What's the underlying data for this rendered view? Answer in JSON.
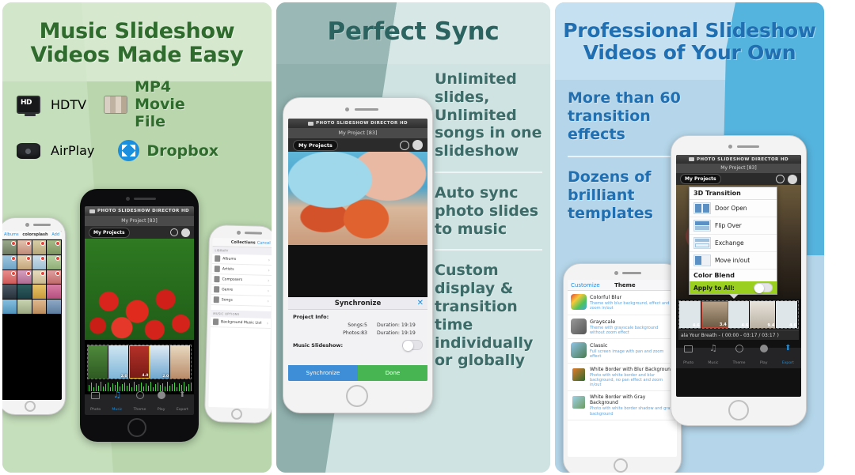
{
  "panels": [
    {
      "id": "panel-1",
      "headline": "Music Slideshow\nVideos Made Easy",
      "headline_line1": "Music Slideshow",
      "headline_line2": "Videos Made Easy",
      "accent": "#2e6b2c",
      "bg_top": "#d6e9cf",
      "bg_bottom": "#b9d6ad",
      "features": [
        {
          "icon": "hdtv-icon",
          "label": "HDTV"
        },
        {
          "icon": "mp4-film-icon",
          "label": "MP4 Movie File"
        },
        {
          "icon": "airplay-icon",
          "label": "AirPlay"
        },
        {
          "icon": "dropbox-icon",
          "label": "Dropbox"
        }
      ],
      "left_phone": {
        "nav_back": "Albums",
        "nav_title": "colorsplash",
        "nav_action": "Add"
      },
      "right_phone": {
        "nav_title": "Collections",
        "nav_action": "Cancel",
        "section_library": "LIBRARY",
        "library_items": [
          "Albums",
          "Artists",
          "Composers",
          "Genre",
          "Songs"
        ],
        "section_options": "MUSIC OPTIONS",
        "option_items": [
          "Background Music List"
        ]
      },
      "main_phone": {
        "app_name": "PHOTO SLIDESHOW DIRECTOR HD",
        "project_title": "My Project [83]",
        "projects_button": "My Projects",
        "timeline_durations": [
          "2.0",
          "4.0",
          "2.0"
        ],
        "tabs": [
          {
            "label": "Photo",
            "icon": "photo-icon",
            "active": false
          },
          {
            "label": "Music",
            "icon": "music-note-icon",
            "active": true
          },
          {
            "label": "Theme",
            "icon": "palette-icon",
            "active": false
          },
          {
            "label": "Play",
            "icon": "play-icon",
            "active": false
          },
          {
            "label": "Export",
            "icon": "export-icon",
            "active": false
          }
        ]
      }
    },
    {
      "id": "panel-2",
      "headline": "Perfect Sync",
      "accent": "#2b6360",
      "bg_light": "#cfe3e2",
      "bg_dark": "#8fb0ad",
      "bullets": [
        "Unlimited slides, Unlimited songs in one slideshow",
        "Auto sync photo slides to music",
        "Custom display & transition time individually or globally"
      ],
      "phone": {
        "app_name": "PHOTO SLIDESHOW DIRECTOR HD",
        "project_title": "My Project [83]",
        "projects_button": "My Projects",
        "dialog": {
          "title": "Synchronize",
          "close_icon": "close-icon",
          "project_info_label": "Project Info:",
          "rows": [
            {
              "count": "Songs:5",
              "duration": "Duration: 19:19"
            },
            {
              "count": "Photos:83",
              "duration": "Duration: 19:19"
            }
          ],
          "toggle_label": "Music Slideshow:",
          "toggle_on": false,
          "buttons": [
            {
              "label": "Synchronize",
              "color": "#3d8ed6"
            },
            {
              "label": "Done",
              "color": "#47b552"
            }
          ]
        }
      }
    },
    {
      "id": "panel-3",
      "headline_line1": "Professional Slideshow",
      "headline_line2": "Videos of Your Own",
      "accent": "#1f6fb2",
      "bg_light": "#c5e0f0",
      "bg_base": "#b5d6ea",
      "bg_poly": "#55b4de",
      "bullets": [
        "More than 60 transition effects",
        "Dozens of brilliant templates"
      ],
      "back_phone": {
        "nav_left": "Customize",
        "nav_title": "Theme",
        "themes": [
          {
            "name": "Colorful Blur",
            "desc": "Theme with blur background, effect and zoom in/out"
          },
          {
            "name": "Grayscale",
            "desc": "Theme with grayscale background without zoom effect"
          },
          {
            "name": "Classic",
            "desc": "Full screen image with pan and zoom effect"
          },
          {
            "name": "White Border with Blur Background",
            "desc": "Photo with white border and blur background, no pan effect and zoom in/out"
          },
          {
            "name": "White Border with Gray Background",
            "desc": "Photo with white border shadow and gray background"
          }
        ]
      },
      "front_phone": {
        "app_name": "PHOTO SLIDESHOW DIRECTOR HD",
        "project_title": "My Project [83]",
        "projects_button": "My Projects",
        "dropdown": {
          "header": "3D Transition",
          "items": [
            {
              "label": "Door Open",
              "icon": "door-open-icon"
            },
            {
              "label": "Flip Over",
              "icon": "flip-over-icon"
            },
            {
              "label": "Exchange",
              "icon": "exchange-icon"
            },
            {
              "label": "Move in/out",
              "icon": "move-in-out-icon"
            }
          ],
          "footer_header": "Color Blend",
          "apply_label": "Apply to All:",
          "apply_on": false,
          "apply_bg": "#9ace1f"
        },
        "timeline_durations": [
          "4.6",
          "3.4",
          "4.6",
          "9.4",
          "4.6"
        ],
        "song_bar": "ala Your Breath - ( 00:00 - 03:17 / 03:17 )",
        "tabs": [
          {
            "label": "Photo",
            "icon": "photo-icon",
            "active": false
          },
          {
            "label": "Music",
            "icon": "music-note-icon",
            "active": false
          },
          {
            "label": "Theme",
            "icon": "palette-icon",
            "active": false
          },
          {
            "label": "Play",
            "icon": "play-icon",
            "active": false
          },
          {
            "label": "Export",
            "icon": "export-icon",
            "active": true
          }
        ]
      }
    }
  ]
}
